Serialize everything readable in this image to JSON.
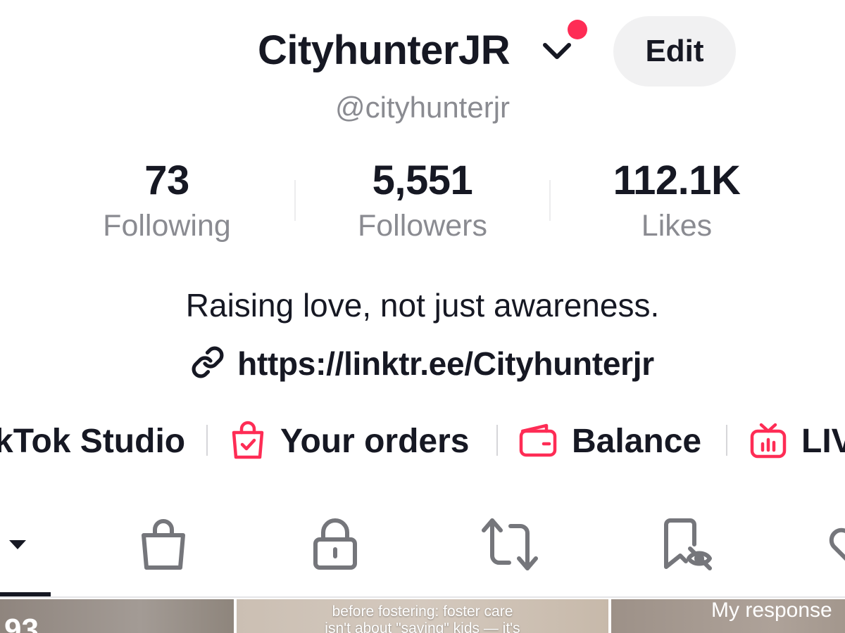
{
  "profile": {
    "display_name": "CityhunterJR",
    "handle": "@cityhunterjr",
    "edit_label": "Edit",
    "bio": "Raising love, not just awareness.",
    "link": "https://linktr.ee/Cityhunterjr"
  },
  "stats": [
    {
      "value": "73",
      "label": "Following"
    },
    {
      "value": "5,551",
      "label": "Followers"
    },
    {
      "value": "112.1K",
      "label": "Likes"
    }
  ],
  "shortcuts": [
    {
      "label": "kTok Studio",
      "icon": "studio-icon"
    },
    {
      "label": "Your orders",
      "icon": "shopping-bag-check-icon"
    },
    {
      "label": "Balance",
      "icon": "wallet-icon"
    },
    {
      "label": "LIV",
      "icon": "live-tv-icon"
    }
  ],
  "tabs": [
    {
      "icon": "videos-dropdown-icon"
    },
    {
      "icon": "shop-bag-icon"
    },
    {
      "icon": "lock-icon"
    },
    {
      "icon": "repost-icon"
    },
    {
      "icon": "hidden-favorites-icon"
    },
    {
      "icon": "liked-heart-icon"
    }
  ],
  "videos": [
    {
      "caption": "93"
    },
    {
      "caption_line1": "before fostering: foster care",
      "caption_line2": "isn't about \"saving\" kids — it's"
    },
    {
      "caption": "My response"
    }
  ],
  "colors": {
    "accent": "#fe2c55",
    "text_primary": "#161823",
    "text_secondary": "#8a8b91",
    "button_bg": "#f1f1f2",
    "icon_gray": "#75767b"
  }
}
